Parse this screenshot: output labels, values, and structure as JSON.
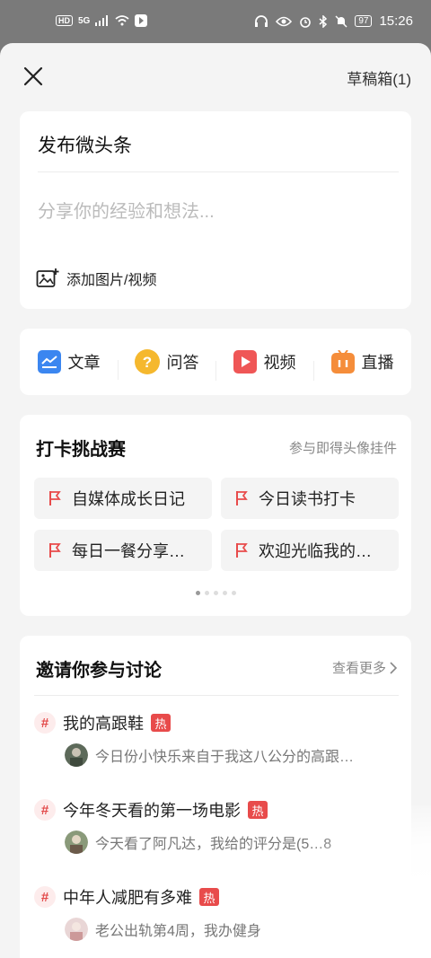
{
  "status_bar": {
    "left": [
      "HD",
      "5G"
    ],
    "battery": "97",
    "time": "15:26"
  },
  "header": {
    "drafts_label": "草稿箱(1)"
  },
  "post": {
    "title": "发布微头条",
    "placeholder": "分享你的经验和想法...",
    "add_media_label": "添加图片/视频"
  },
  "post_types": [
    {
      "label": "文章",
      "icon": "article-icon",
      "color": "#3b86f0"
    },
    {
      "label": "问答",
      "icon": "question-icon",
      "color": "#f5b82e"
    },
    {
      "label": "视频",
      "icon": "video-play-icon",
      "color": "#ef5656"
    },
    {
      "label": "直播",
      "icon": "live-tv-icon",
      "color": "#f58d3a"
    }
  ],
  "challenge": {
    "title": "打卡挑战赛",
    "subtitle": "参与即得头像挂件",
    "items": [
      "自媒体成长日记",
      "今日读书打卡",
      "每日一餐分享…",
      "欢迎光临我的…"
    ],
    "page_count": 5,
    "active_page": 1
  },
  "discussion": {
    "title": "邀请你参与讨论",
    "more_label": "查看更多",
    "topics": [
      {
        "title": "我的高跟鞋",
        "badge": "热",
        "excerpt": "今日份小快乐来自于我这八公分的高跟…"
      },
      {
        "title": "今年冬天看的第一场电影",
        "badge": "热",
        "excerpt": "今天看了阿凡达，我给的评分是(5…8"
      },
      {
        "title": "中年人减肥有多难",
        "badge": "热",
        "excerpt": "老公出轨第4周，我办健身"
      }
    ]
  },
  "colors": {
    "accent_red": "#e84b4b",
    "card_bg": "#ffffff",
    "sheet_bg": "#f4f4f4"
  }
}
